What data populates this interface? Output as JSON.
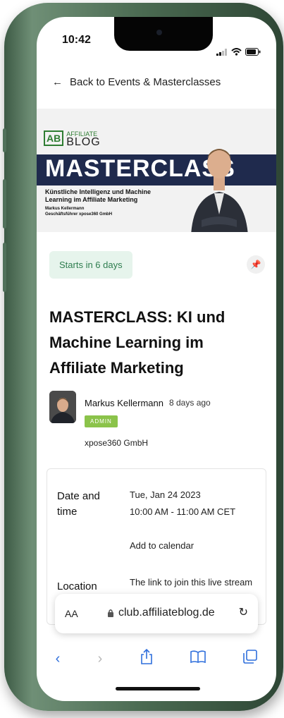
{
  "status": {
    "time": "10:42"
  },
  "nav": {
    "back_label": "Back to Events & Masterclasses"
  },
  "banner": {
    "logo_mark": "AB",
    "logo_top": "AFFILIATE",
    "logo_bottom": "BLOG",
    "title": "MASTERCLASS",
    "subtitle": "Künstliche Intelligenz und Machine Learning im Affiliate Marketing",
    "author_line1": "Markus Kellermann",
    "author_line2": "Geschäftsführer xpose360 GmbH"
  },
  "event": {
    "starts_badge": "Starts in 6 days",
    "title": "MASTERCLASS: KI und Machine Learning im Affiliate Marketing",
    "author_name": "Markus Kellermann",
    "posted_ago": "8 days ago",
    "role_badge": "ADMIN",
    "company": "xpose360 GmbH"
  },
  "details": {
    "date_label": "Date and time",
    "date_value": "Tue, Jan 24 2023",
    "time_value": "10:00 AM - 11:00 AM CET",
    "add_calendar": "Add to calendar",
    "location_label": "Location",
    "location_value": "The link to join this live stream"
  },
  "browser": {
    "aa_label": "AA",
    "url": "club.affiliateblog.de"
  },
  "icons": {
    "back": "arrow-left-icon",
    "pin": "pin-icon",
    "lock": "lock-icon",
    "reload": "reload-icon",
    "toolbar": [
      "chevron-left-icon",
      "chevron-right-icon",
      "share-icon",
      "bookmarks-icon",
      "tabs-icon"
    ]
  },
  "colors": {
    "accent": "#2f6fdc",
    "badge_green": "#8bc34a",
    "starts_bg": "#e6f4ec",
    "banner_navy": "#1f2a4d"
  }
}
